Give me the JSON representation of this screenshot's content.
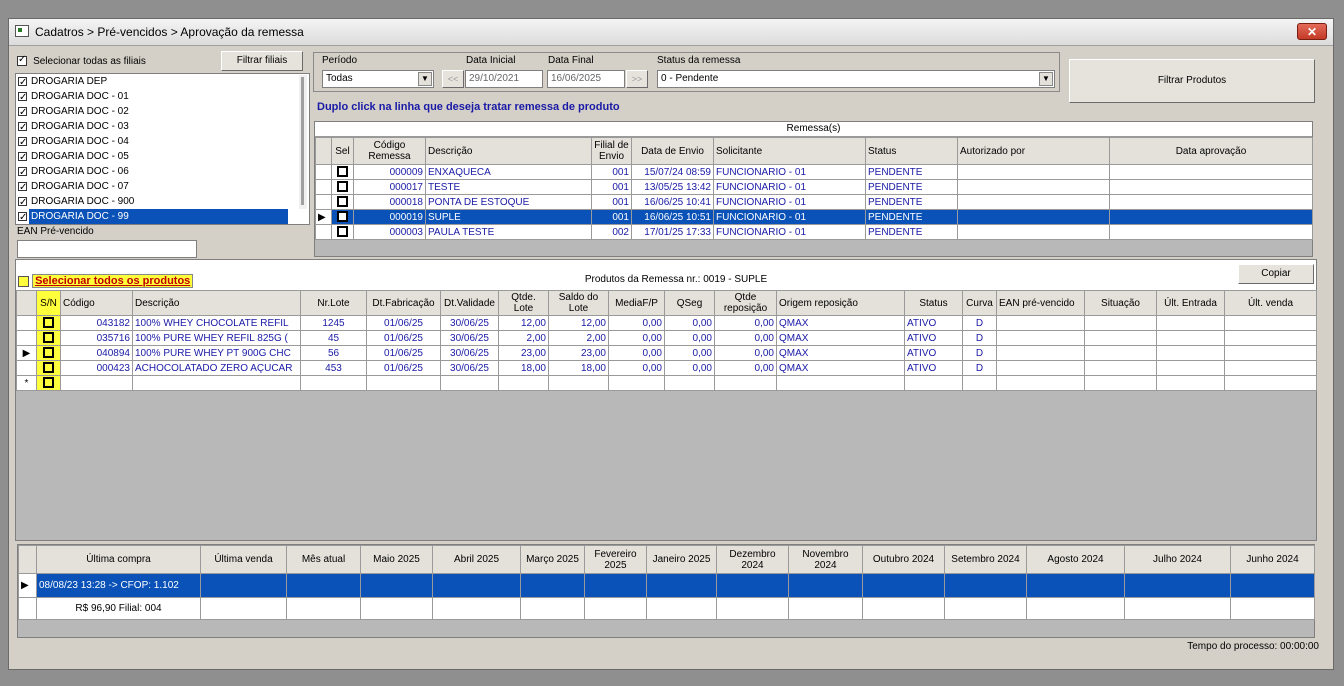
{
  "window": {
    "title": "Cadatros > Pré-vencidos > Aprovação da remessa",
    "close": "✕"
  },
  "branches": {
    "select_all_label": "Selecionar todas as filiais",
    "filter_button": "Filtrar filiais",
    "items": [
      "DROGARIA DEP",
      "DROGARIA DOC - 01",
      "DROGARIA DOC - 02",
      "DROGARIA DOC - 03",
      "DROGARIA DOC - 04",
      "DROGARIA DOC - 05",
      "DROGARIA DOC - 06",
      "DROGARIA DOC - 07",
      "DROGARIA DOC - 900",
      "DROGARIA DOC - 99"
    ],
    "ean_label": "EAN Pré-vencido",
    "ean_value": ""
  },
  "filters": {
    "periodo_label": "Período",
    "periodo_value": "Todas",
    "data_inicial_label": "Data Inicial",
    "data_inicial_value": "29/10/2021",
    "data_final_label": "Data Final",
    "data_final_value": "16/06/2025",
    "prev": "<<",
    "next": ">>",
    "status_label": "Status da remessa",
    "status_value": "0 - Pendente",
    "filter_products_button": "Filtrar Produtos",
    "instruction": "Duplo click na linha que deseja tratar remessa de produto"
  },
  "remessas": {
    "caption": "Remessa(s)",
    "headers": [
      "Sel",
      "Código Remessa",
      "Descrição",
      "Filial de Envio",
      "Data de Envio",
      "Solicitante",
      "Status",
      "Autorizado por",
      "Data aprovação"
    ],
    "rows": [
      {
        "codigo": "000009",
        "descricao": "ENXAQUECA",
        "filial": "001",
        "data": "15/07/24 08:59",
        "solicitante": "FUNCIONARIO - 01",
        "status": "PENDENTE"
      },
      {
        "codigo": "000017",
        "descricao": "TESTE",
        "filial": "001",
        "data": "13/05/25 13:42",
        "solicitante": "FUNCIONARIO - 01",
        "status": "PENDENTE"
      },
      {
        "codigo": "000018",
        "descricao": "PONTA DE ESTOQUE",
        "filial": "001",
        "data": "16/06/25 10:41",
        "solicitante": "FUNCIONARIO - 01",
        "status": "PENDENTE"
      },
      {
        "codigo": "000019",
        "descricao": "SUPLE",
        "filial": "001",
        "data": "16/06/25 10:51",
        "solicitante": "FUNCIONARIO - 01",
        "status": "PENDENTE"
      },
      {
        "codigo": "000003",
        "descricao": "PAULA TESTE",
        "filial": "002",
        "data": "17/01/25 17:33",
        "solicitante": "FUNCIONARIO - 01",
        "status": "PENDENTE"
      }
    ]
  },
  "produtos": {
    "select_all_label": "Selecionar todos os produtos",
    "caption": "Produtos da Remessa nr.: 0019 - SUPLE",
    "copy_button": "Copiar",
    "headers": [
      "S/N",
      "Código",
      "Descrição",
      "Nr.Lote",
      "Dt.Fabricação",
      "Dt.Validade",
      "Qtde. Lote",
      "Saldo do Lote",
      "MediaF/P",
      "QSeg",
      "Qtde reposição",
      "Origem reposição",
      "Status",
      "Curva",
      "EAN pré-vencido",
      "Situação",
      "Últ. Entrada",
      "Últ. venda"
    ],
    "rows": [
      {
        "codigo": "043182",
        "descricao": "100% WHEY CHOCOLATE REFIL",
        "lote": "1245",
        "fab": "01/06/25",
        "val": "30/06/25",
        "qtde": "12,00",
        "saldo": "12,00",
        "media": "0,00",
        "qseg": "0,00",
        "repos": "0,00",
        "origem": "QMAX",
        "status": "ATIVO",
        "curva": "D"
      },
      {
        "codigo": "035716",
        "descricao": "100% PURE WHEY REFIL 825G (",
        "lote": "45",
        "fab": "01/06/25",
        "val": "30/06/25",
        "qtde": "2,00",
        "saldo": "2,00",
        "media": "0,00",
        "qseg": "0,00",
        "repos": "0,00",
        "origem": "QMAX",
        "status": "ATIVO",
        "curva": "D"
      },
      {
        "codigo": "040894",
        "descricao": "100% PURE WHEY PT 900G CHC",
        "lote": "56",
        "fab": "01/06/25",
        "val": "30/06/25",
        "qtde": "23,00",
        "saldo": "23,00",
        "media": "0,00",
        "qseg": "0,00",
        "repos": "0,00",
        "origem": "QMAX",
        "status": "ATIVO",
        "curva": "D"
      },
      {
        "codigo": "000423",
        "descricao": "ACHOCOLATADO ZERO AÇUCAR",
        "lote": "453",
        "fab": "01/06/25",
        "val": "30/06/25",
        "qtde": "18,00",
        "saldo": "18,00",
        "media": "0,00",
        "qseg": "0,00",
        "repos": "0,00",
        "origem": "QMAX",
        "status": "ATIVO",
        "curva": "D"
      }
    ]
  },
  "historico": {
    "headers": [
      "Última compra",
      "Última venda",
      "Mês atual",
      "Maio 2025",
      "Abril 2025",
      "Março 2025",
      "Fevereiro 2025",
      "Janeiro 2025",
      "Dezembro 2024",
      "Novembro 2024",
      "Outubro 2024",
      "Setembro 2024",
      "Agosto 2024",
      "Julho 2024",
      "Junho 2024"
    ],
    "row1": "08/08/23 13:28 -> CFOP: 1.102",
    "row2": "R$ 96,90 Filial: 004"
  },
  "status_bar": {
    "tempo": "Tempo do processo: 00:00:00"
  }
}
